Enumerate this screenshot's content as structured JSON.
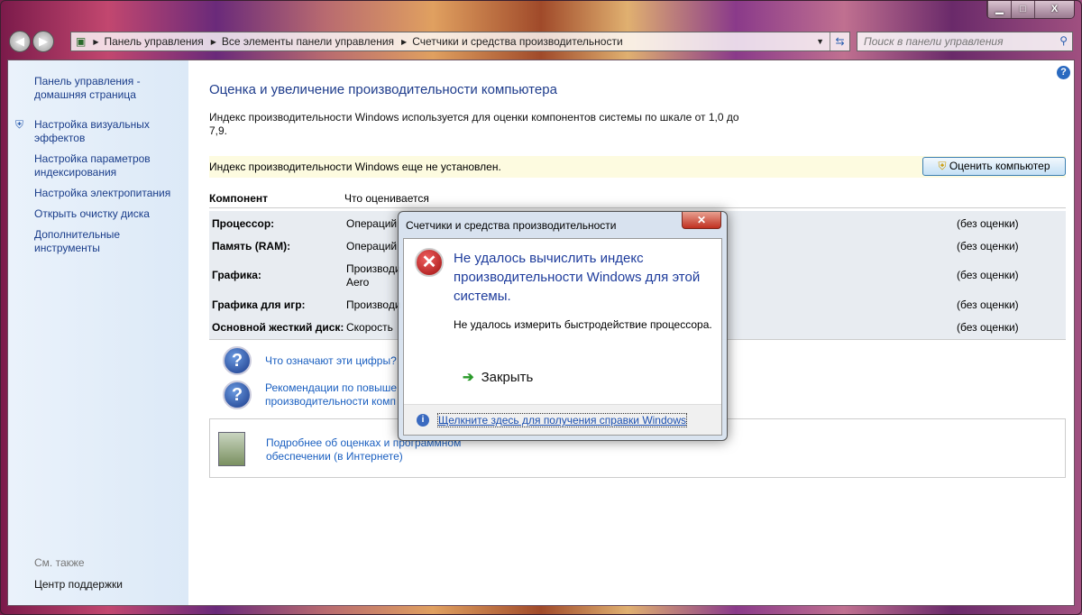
{
  "window": {
    "minimize": "▁",
    "maximize": "□",
    "close": "X"
  },
  "address": {
    "segments": [
      "Панель управления",
      "Все элементы панели управления",
      "Счетчики и средства производительности"
    ],
    "search_placeholder": "Поиск в панели управления"
  },
  "sidebar": {
    "home": "Панель управления - домашняя страница",
    "items": [
      "Настройка визуальных эффектов",
      "Настройка параметров индексирования",
      "Настройка электропитания",
      "Открыть очистку диска",
      "Дополнительные инструменты"
    ],
    "see_also": "См. также",
    "support": "Центр поддержки"
  },
  "main": {
    "title": "Оценка и увеличение производительности компьютера",
    "intro": "Индекс производительности Windows используется для оценки компонентов системы по шкале от 1,0 до 7,9.",
    "not_set": "Индекс производительности Windows еще не установлен.",
    "rate_button": "Оценить компьютер",
    "col_component": "Компонент",
    "col_what": "Что оценивается",
    "rows": [
      {
        "name": "Процессор:",
        "what": "Операций",
        "score": "(без оценки)"
      },
      {
        "name": "Память (RAM):",
        "what": "Операций",
        "score": "(без оценки)"
      },
      {
        "name": "Графика:",
        "what": "Производи",
        "what2": "Aero",
        "score": "(без оценки)"
      },
      {
        "name": "Графика для игр:",
        "what": "Производи",
        "score": "(без оценки)"
      },
      {
        "name": "Основной жесткий диск:",
        "what": "Скорость",
        "score": "(без оценки)"
      }
    ],
    "link1": "Что означают эти цифры?",
    "link2a": "Рекомендации по повыше",
    "link2b": "производительности комп",
    "link3a": "Подробнее об оценках и программном",
    "link3b": "обеспечении (в Интернете)"
  },
  "dialog": {
    "title": "Счетчики и средства производительности",
    "instruction": "Не удалось вычислить индекс производительности Windows для этой системы.",
    "detail": "Не удалось измерить быстродействие процессора.",
    "close": "Закрыть",
    "help_link": "Щелкните здесь для получения справки Windows"
  }
}
